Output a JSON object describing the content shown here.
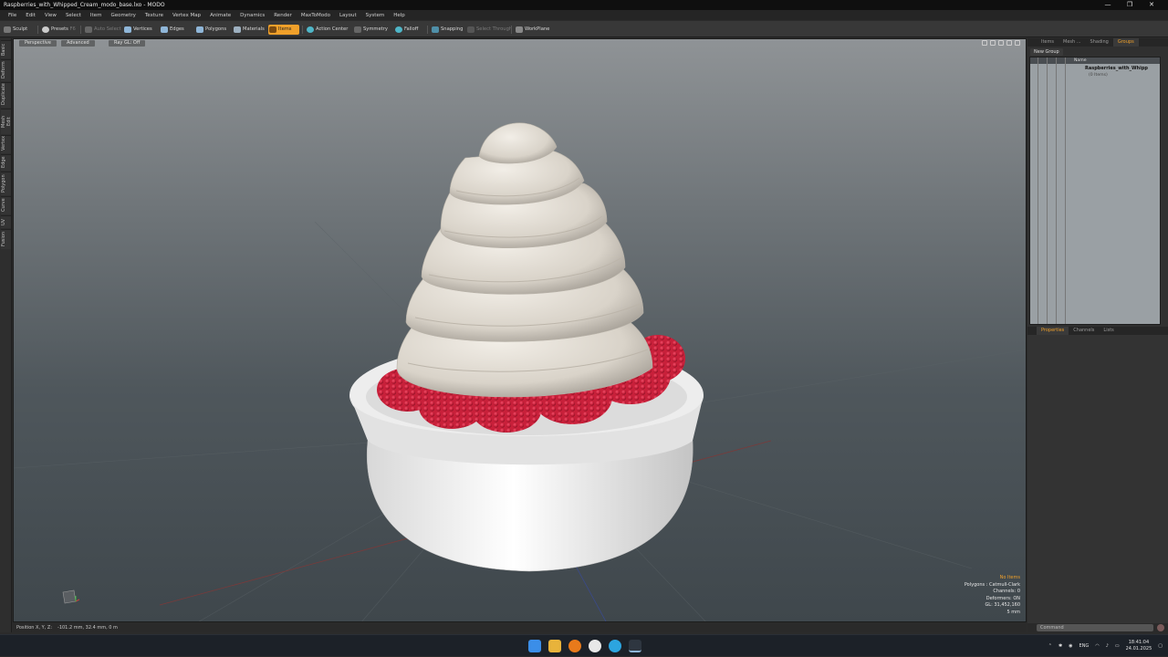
{
  "window": {
    "title": "Raspberries_with_Whipped_Cream_modo_base.lxo - MODO",
    "controls": [
      "—",
      "❐",
      "✕"
    ]
  },
  "menu": [
    "File",
    "Edit",
    "View",
    "Select",
    "Item",
    "Geometry",
    "Texture",
    "Vertex Map",
    "Animate",
    "Dynamics",
    "Render",
    "MaxToModo",
    "Layout",
    "System",
    "Help"
  ],
  "toolbar": {
    "sculpt": "Sculpt",
    "presets": "Presets",
    "presets_key": "F6",
    "auto_select": "Auto Select",
    "vertices": "Vertices",
    "edges": "Edges",
    "polygons": "Polygons",
    "materials": "Materials",
    "items": "Items",
    "action_center": "Action Center",
    "symmetry": "Symmetry",
    "falloff": "Falloff",
    "snapping": "Snapping",
    "select_through": "Select Through",
    "workplane": "WorkPlane"
  },
  "left_tabs": [
    "Basic",
    "Deform",
    "Duplicate",
    "Mesh Edit",
    "Vertex",
    "Edge",
    "Polygon",
    "Curve",
    "UV",
    "Fusion"
  ],
  "viewport": {
    "perspective": "Perspective",
    "advanced": "Advanced",
    "raygl": "Ray GL: Off"
  },
  "stats": {
    "no_items": "No Items",
    "polygons": "Polygons : Catmull-Clark",
    "channels": "Channels: 0",
    "deformers": "Deformers: ON",
    "gl": "GL: 31,452,160",
    "unit": "5 mm"
  },
  "status": {
    "label": "Position X, Y, Z:",
    "value": "-101.2 mm, 32.4 mm, 0 m"
  },
  "right": {
    "tabs_top": [
      "Items",
      "Mesh ...",
      "Shading",
      "Groups"
    ],
    "new_group": "New Group",
    "col_name": "Name",
    "group_name": "Raspberries_with_Whipp",
    "group_sub": "(0 Items)",
    "tabs_bottom": [
      "Properties",
      "Channels",
      "Lists"
    ],
    "command_placeholder": "Command"
  },
  "tray": {
    "lang": "ENG",
    "time": "18:41:04",
    "date": "24.01.2025"
  },
  "colors": {
    "accent": "#f0a02a",
    "cream": "#e6e1d8",
    "raspberry": "#c8203a",
    "bowl": "#f4f4f4"
  }
}
